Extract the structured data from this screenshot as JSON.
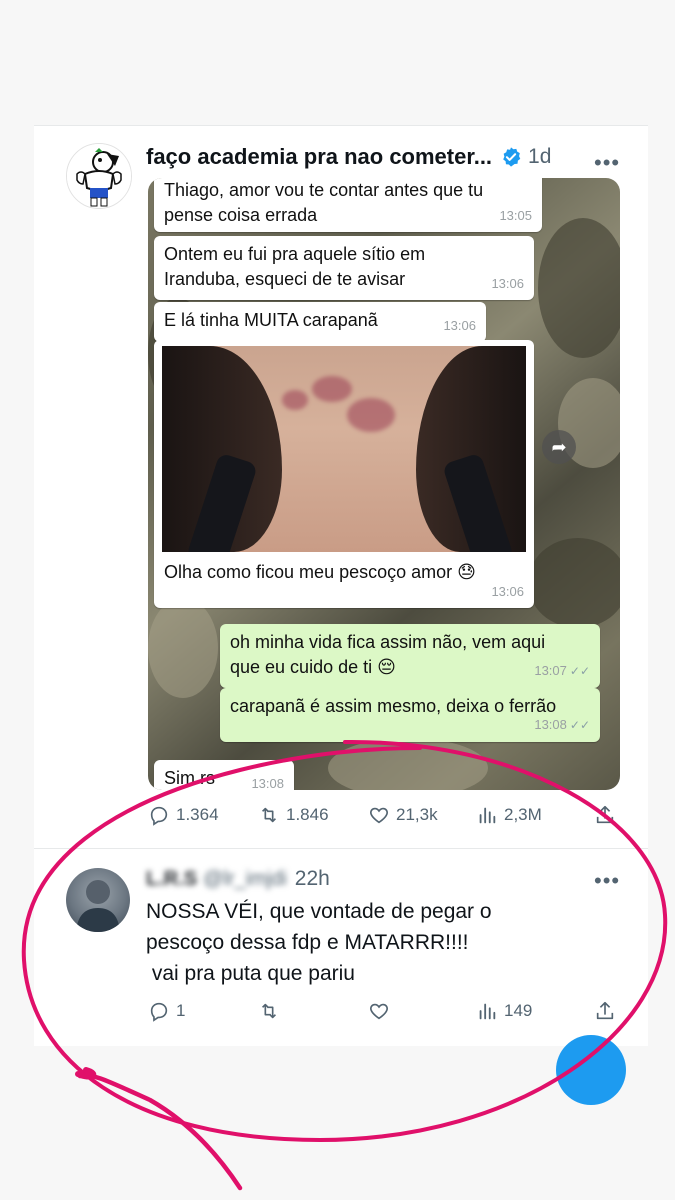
{
  "tweet": {
    "author_name": "faço academia pra nao cometer...",
    "time": "1d",
    "more": "•••",
    "stats": {
      "replies": "1.364",
      "retweets": "1.846",
      "likes": "21,3k",
      "views": "2,3M"
    }
  },
  "chat": {
    "messages": [
      {
        "text": "Thiago, amor vou te contar antes que tu\npense coisa errada",
        "time": "13:05",
        "side": "in"
      },
      {
        "text": "Ontem eu fui pra aquele sítio em\nIranduba, esqueci de te avisar",
        "time": "13:06",
        "side": "in"
      },
      {
        "text": "E lá tinha MUITA carapanã",
        "time": "13:06",
        "side": "in"
      },
      {
        "text": "Olha como ficou meu pescoço amor 😓",
        "time": "13:06",
        "side": "in"
      },
      {
        "text": "oh minha vida fica assim não, vem aqui\nque eu cuido de ti 😔",
        "time": "13:07",
        "side": "out"
      },
      {
        "text": "carapanã é assim mesmo, deixa o ferrão",
        "time": "13:08",
        "side": "out"
      },
      {
        "text": "Sim rs",
        "time": "13:08",
        "side": "in"
      }
    ],
    "checks": "✓✓"
  },
  "reply": {
    "name_blurred": "L.R.S",
    "handle_blurred": "@lr_imjdi",
    "time": "22h",
    "more": "•••",
    "lines": [
      "NOSSA VÉI, que vontade de pegar o",
      "pescoço dessa fdp e MATARRR!!!!",
      " vai pra puta que pariu"
    ],
    "stats": {
      "replies": "1",
      "views": "149"
    }
  },
  "icons": {
    "verified": "verified-badge-icon",
    "reply": "reply-icon",
    "retweet": "retweet-icon",
    "like": "heart-icon",
    "views": "views-icon",
    "share": "share-icon"
  },
  "colors": {
    "accent": "#1d9bf0",
    "annotation": "#e0106a",
    "bubble_out": "#dcf8c6"
  }
}
